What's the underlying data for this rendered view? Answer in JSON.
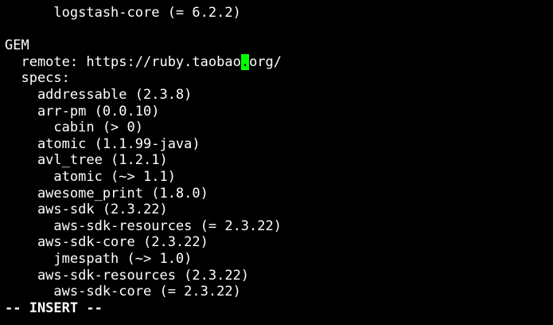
{
  "terminal": {
    "lines": [
      "      logstash-core (= 6.2.2)",
      "",
      "GEM",
      "  remote: https://ruby.taobao.org/",
      "  specs:",
      "    addressable (2.3.8)",
      "    arr-pm (0.0.10)",
      "      cabin (> 0)",
      "    atomic (1.1.99-java)",
      "    avl_tree (1.2.1)",
      "      atomic (~> 1.1)",
      "    awesome_print (1.8.0)",
      "    aws-sdk (2.3.22)",
      "      aws-sdk-resources (= 2.3.22)",
      "    aws-sdk-core (2.3.22)",
      "      jmespath (~> 1.0)",
      "    aws-sdk-resources (2.3.22)",
      "      aws-sdk-core (= 2.3.22)"
    ],
    "remote_prefix": "  remote: https://ruby.taobao",
    "cursor_char": ".",
    "remote_suffix": "org/",
    "mode_text": "-- INSERT --",
    "colors": {
      "background": "#000000",
      "text": "#ffffff",
      "cursor": "#00ff00"
    }
  }
}
